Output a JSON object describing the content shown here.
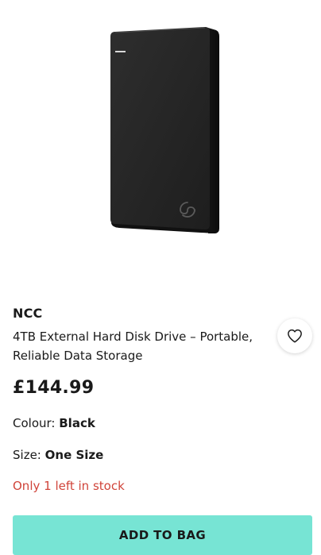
{
  "product": {
    "brand": "NCC",
    "title": "4TB External Hard Disk Drive – Portable, Reliable Data Storage",
    "price": "£144.99",
    "colour_label": "Colour:",
    "colour_value": "Black",
    "size_label": "Size:",
    "size_value": "One Size",
    "stock_text": "Only 1 left in stock"
  },
  "actions": {
    "add_to_bag_label": "ADD TO BAG"
  },
  "icons": {
    "wishlist": "heart-icon",
    "drive_logo": "seagate-logo-icon"
  },
  "colors": {
    "accent": "#77e4d4",
    "stock_warning": "#d0443a",
    "text": "#1a1a1a"
  }
}
